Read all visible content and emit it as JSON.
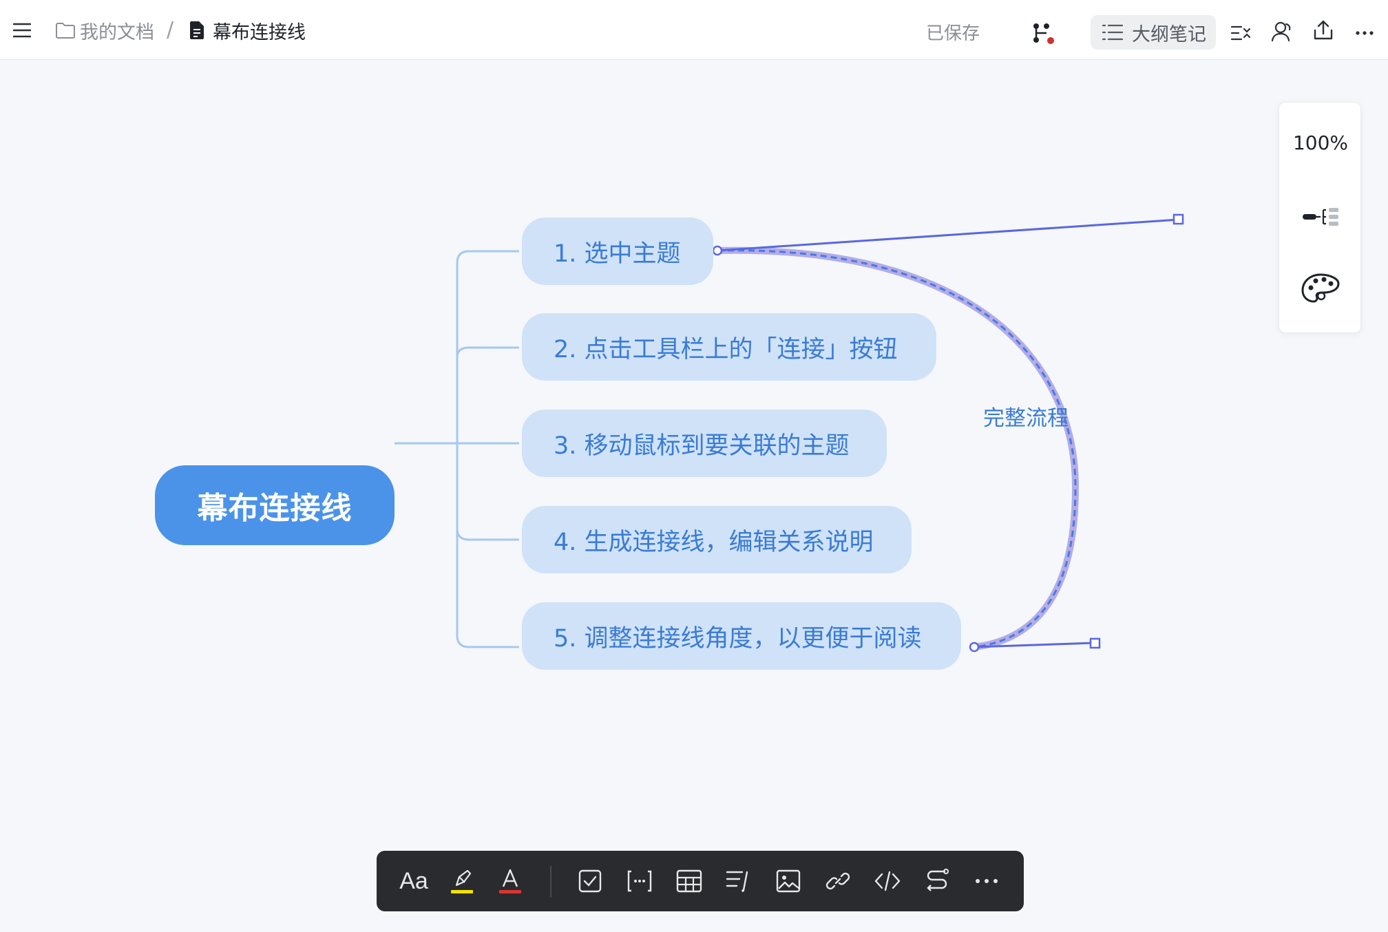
{
  "breadcrumb": {
    "root": "我的文档",
    "separator": "/",
    "doc": "幕布连接线"
  },
  "header": {
    "status": "已保存",
    "outline_label": "大纲笔记"
  },
  "mindmap": {
    "root": "幕布连接线",
    "topics": [
      "1. 选中主题",
      "2. 点击工具栏上的「连接」按钮",
      "3. 移动鼠标到要关联的主题",
      "4. 生成连接线，编辑关系说明",
      "5. 调整连接线角度，以更便于阅读"
    ],
    "relation_label": "完整流程"
  },
  "side_panel": {
    "zoom": "100%"
  },
  "toolbar": {
    "text_style": "Aa"
  },
  "colors": {
    "root_fill": "#4b93e8",
    "topic_fill": "#cfe2f8",
    "topic_text": "#3a7bd5",
    "branch_line": "#a6c8ee",
    "relation_line": "#5a67e0"
  }
}
